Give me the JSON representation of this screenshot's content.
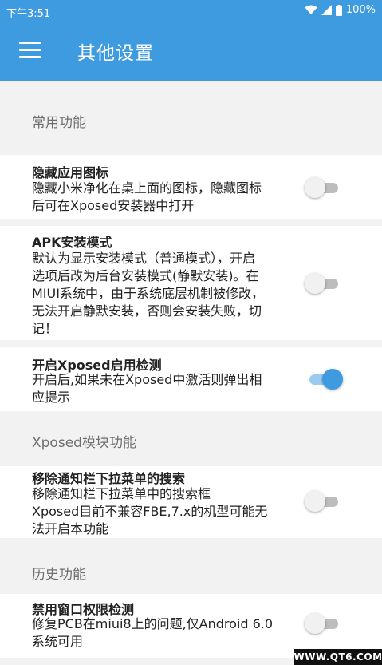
{
  "status_bar": {
    "time": "下午3:51",
    "battery": "100%",
    "icons": [
      "wifi-icon",
      "signal-icon",
      "battery-icon"
    ]
  },
  "app_bar": {
    "title": "其他设置",
    "menu_icon": "hamburger-menu-icon",
    "color": "#3f9be0"
  },
  "sections": [
    {
      "header": "常用功能",
      "items": [
        {
          "title": "隐藏应用图标",
          "desc_lines": [
            "隐藏小米净化在桌上面的图标，隐藏图标",
            "后可在Xposed安装器中打开"
          ],
          "enabled": false
        },
        {
          "title": "APK安装模式",
          "desc_lines": [
            "默认为显示安装模式（普通模式），开启",
            "选项后改为后台安装模式(静默安装)。在",
            "MIUI系统中，由于系统底层机制被修改，",
            "无法开启静默安装，否则会安装失败，切",
            "记！"
          ],
          "enabled": false
        },
        {
          "title": "开启Xposed启用检测",
          "desc_lines": [
            "开启后,如果未在Xposed中激活则弹出相",
            "应提示"
          ],
          "enabled": true
        }
      ]
    },
    {
      "header": "Xposed模块功能",
      "items": [
        {
          "title": "移除通知栏下拉菜单的搜索",
          "desc_lines": [
            "移除通知栏下拉菜单中的搜索框",
            "Xposed目前不兼容FBE,7.x的机型可能无",
            "法开启本功能"
          ],
          "enabled": false
        }
      ]
    },
    {
      "header": "历史功能",
      "items": [
        {
          "title": "禁用窗口权限检测",
          "desc_lines": [
            "修复PCB在miui8上的问题,仅Android 6.0",
            "系统可用"
          ],
          "enabled": false
        }
      ]
    }
  ],
  "watermark": "WWW.QT6.COM"
}
